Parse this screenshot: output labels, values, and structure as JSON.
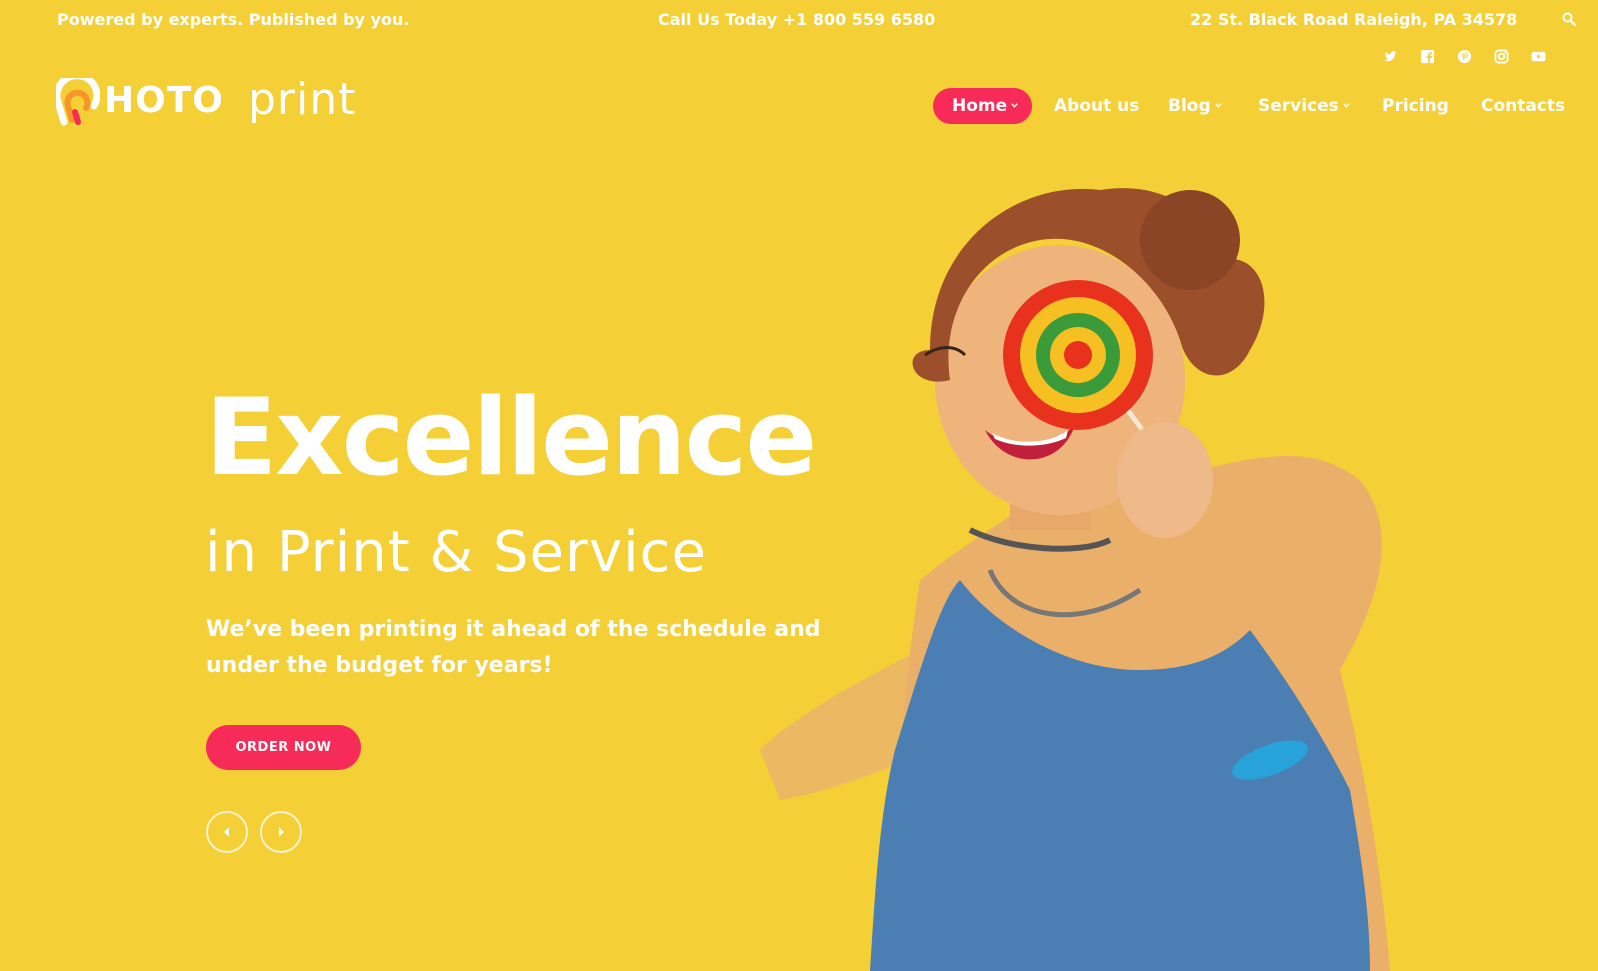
{
  "topbar": {
    "tagline": "Powered by experts. Published by you.",
    "phone": "Call Us Today +1 800 559 6580",
    "address": "22 St. Black Road Raleigh, PA 34578",
    "search_icon": "search-icon"
  },
  "social": [
    "twitter-icon",
    "facebook-icon",
    "pinterest-icon",
    "instagram-icon",
    "youtube-icon"
  ],
  "logo": {
    "bold": "HOTO",
    "light": "print"
  },
  "nav": [
    {
      "label": "Home",
      "dropdown": true,
      "active": true
    },
    {
      "label": "About us",
      "dropdown": false
    },
    {
      "label": "Blog",
      "dropdown": true
    },
    {
      "label": "Services",
      "dropdown": true
    },
    {
      "label": "Pricing",
      "dropdown": false
    },
    {
      "label": "Contacts",
      "dropdown": false
    }
  ],
  "hero": {
    "title": "Excellence",
    "subtitle": "in Print & Service",
    "description": "We’ve been printing it ahead of the schedule and under the budget for years!",
    "cta": "ORDER NOW"
  },
  "colors": {
    "background": "#f5cf36",
    "accent": "#f72b58",
    "text": "#ffffff"
  }
}
